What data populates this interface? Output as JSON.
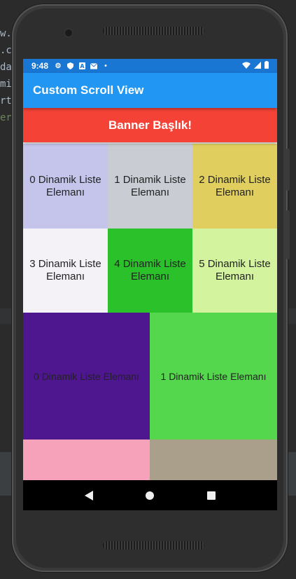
{
  "editor": {
    "code_lines": [
      "w.",
      ".c",
      "da",
      "mi",
      "rt",
      "er"
    ]
  },
  "status_bar": {
    "time": "9:48",
    "icons": [
      "gear-icon",
      "shield-icon",
      "a-icon",
      "mail-icon",
      "dot-icon"
    ],
    "right_icons": [
      "wifi-icon",
      "signal-icon",
      "battery-icon"
    ]
  },
  "app_bar": {
    "title": "Custom Scroll View",
    "color": "#2196f3"
  },
  "banner": {
    "label": "Banner Başlık!",
    "color": "#f44336"
  },
  "grid3": [
    {
      "label": "0 Dinamik Liste Elemanı",
      "color": "#c5c5ec"
    },
    {
      "label": "1 Dinamik Liste Elemanı",
      "color": "#c9cdd3"
    },
    {
      "label": "2 Dinamik Liste Elemanı",
      "color": "#e0cf5f"
    },
    {
      "label": "3 Dinamik Liste Elemanı",
      "color": "#f5f2f7"
    },
    {
      "label": "4 Dinamik Liste Elemanı",
      "color": "#2ac12a"
    },
    {
      "label": "5 Dinamik Liste Elemanı",
      "color": "#d3f39f"
    }
  ],
  "grid2": [
    {
      "label": "0 Dinamik Liste Elemanı",
      "color": "#4e178f"
    },
    {
      "label": "1 Dinamik Liste Elemanı",
      "color": "#55d74d"
    },
    {
      "label": "",
      "color": "#f6a2bb"
    },
    {
      "label": "",
      "color": "#a99f8b"
    }
  ]
}
